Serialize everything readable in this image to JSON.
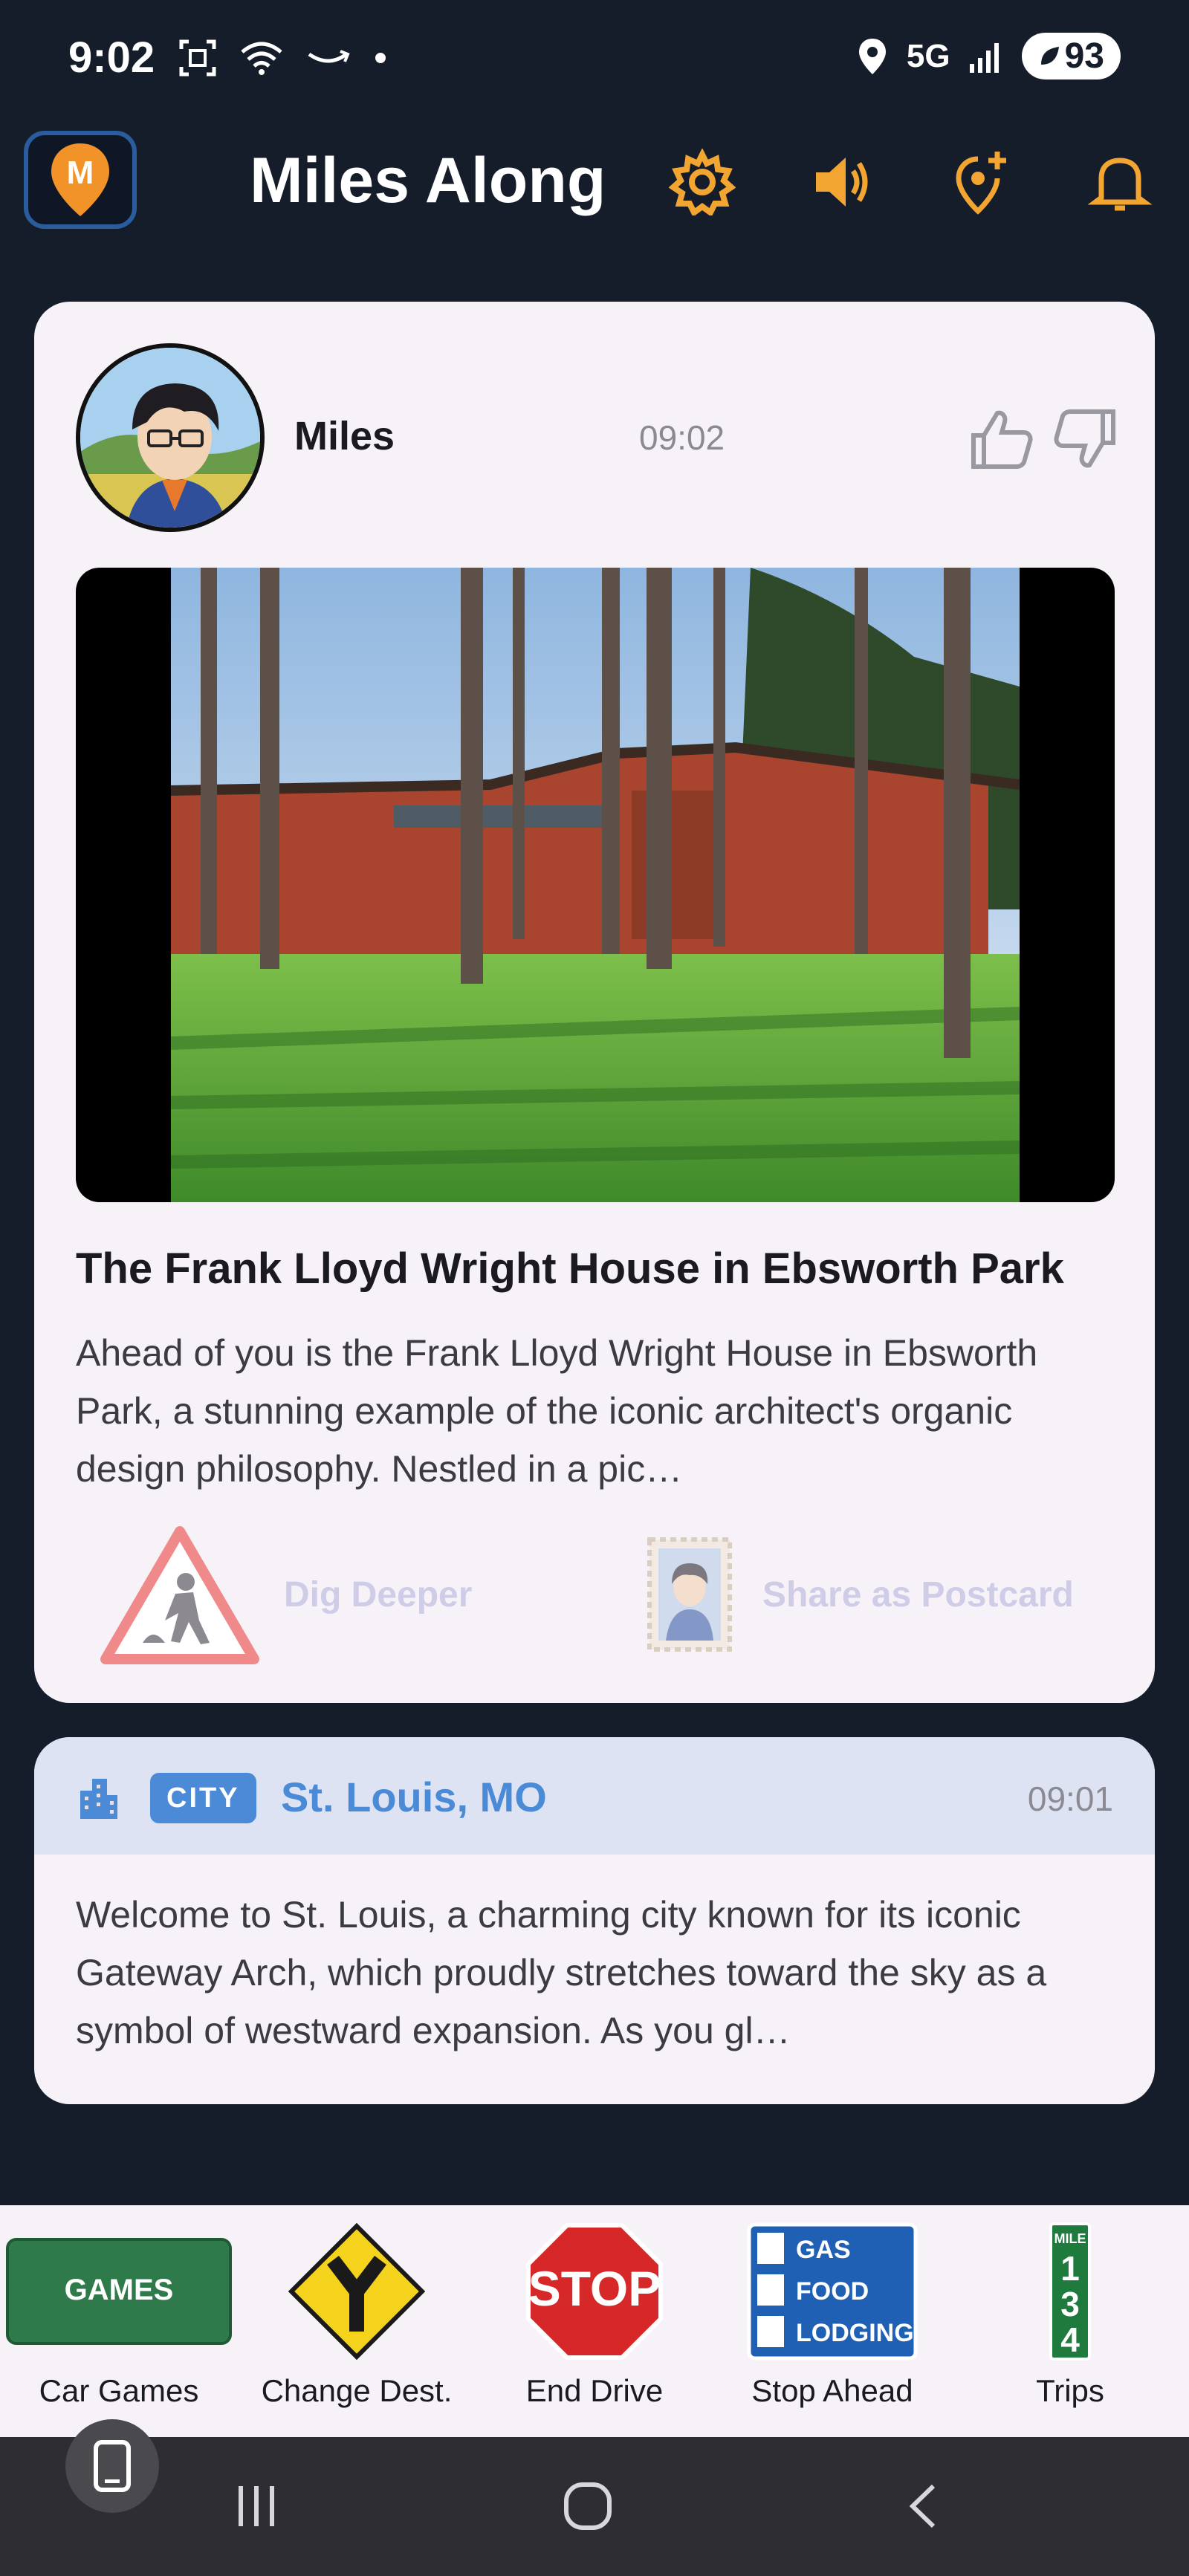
{
  "status_bar": {
    "time": "9:02",
    "network": "5G",
    "battery": "93"
  },
  "app": {
    "title": "Miles Along",
    "logo_letter": "M",
    "accent": "#f2a531",
    "header_icons": [
      "gear-icon",
      "speaker-icon",
      "add-location-icon",
      "bell-icon"
    ]
  },
  "post": {
    "author": "Miles",
    "time": "09:02",
    "title": "The Frank Lloyd Wright House in Ebsworth Park",
    "body": "Ahead of you is the Frank Lloyd Wright House in Ebsworth Park, a stunning example of the iconic architect's organic design philosophy. Nestled in a pic…",
    "actions": {
      "dig_deeper": "Dig Deeper",
      "share_postcard": "Share as Postcard"
    }
  },
  "city_card": {
    "badge": "CITY",
    "name": "St. Louis, MO",
    "time": "09:01",
    "body": "Welcome to St. Louis, a charming city known for its iconic Gateway Arch, which proudly stretches toward the sky as a symbol of westward expansion. As you gl…"
  },
  "bottom_nav": {
    "items": [
      {
        "label": "Car Games",
        "sign_text": "GAMES"
      },
      {
        "label": "Change Dest.",
        "sign_text": ""
      },
      {
        "label": "End Drive",
        "sign_text": "STOP"
      },
      {
        "label": "Stop Ahead",
        "sign_lines": [
          "GAS",
          "FOOD",
          "LODGING"
        ]
      },
      {
        "label": "Trips",
        "sign_lines": [
          "MILE",
          "1",
          "3",
          "4"
        ]
      }
    ]
  }
}
